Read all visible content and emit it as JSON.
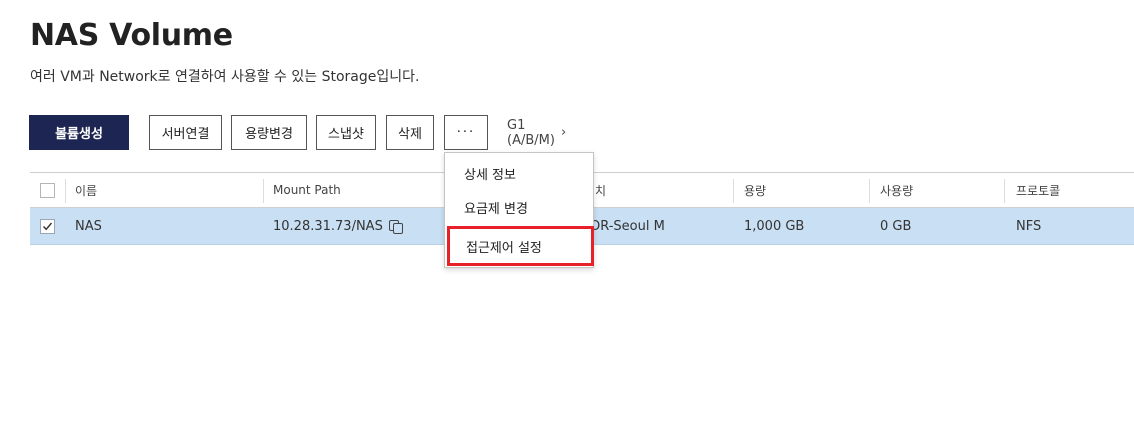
{
  "page": {
    "title": "NAS Volume",
    "subtitle": "여러 VM과 Network로 연결하여 사용할 수 있는 Storage입니다."
  },
  "toolbar": {
    "create_label": "볼륨생성",
    "server_connect_label": "서버연결",
    "resize_label": "용량변경",
    "snapshot_label": "스냅샷",
    "delete_label": "삭제",
    "more_label": "···",
    "generation_label": "G1 (A/B/M)",
    "generation_chevron": "›"
  },
  "table": {
    "headers": [
      "이름",
      "Mount Path",
      "치",
      "용량",
      "사용량",
      "프로토콜"
    ],
    "rows": [
      {
        "checked": true,
        "name": "NAS",
        "mount_path": "10.28.31.73/NAS",
        "location": "OR-Seoul M",
        "capacity": "1,000 GB",
        "used": "0 GB",
        "protocol": "NFS"
      }
    ]
  },
  "dropdown": {
    "items": [
      {
        "label": "상세 정보",
        "highlighted": false
      },
      {
        "label": "요금제 변경",
        "highlighted": false
      },
      {
        "label": "접근제어 설정",
        "highlighted": true
      }
    ]
  },
  "colors": {
    "primary_button": "#1d2652",
    "selected_row": "#c9dff3",
    "highlight_border": "#e8202a"
  }
}
